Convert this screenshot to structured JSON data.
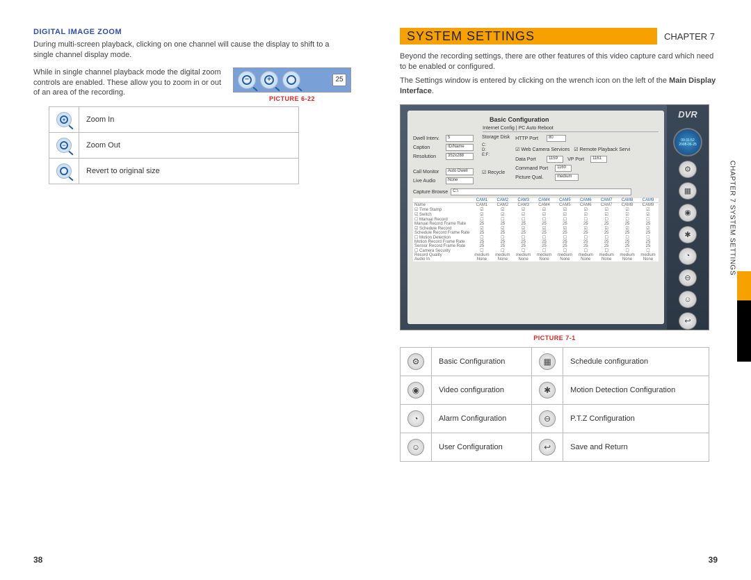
{
  "left": {
    "section_title": "DIGITAL IMAGE ZOOM",
    "para1": "During multi-screen playback, clicking on one channel will cause the display to shift to a single channel display mode.",
    "para2": "While in single channel playback mode the digital zoom controls are enabled. These allow you to zoom in or out of an area of the recording.",
    "pic622": {
      "label": "PICTURE 6-22",
      "num": "25"
    },
    "zoom_table": [
      {
        "icon": "zoom-in-icon",
        "text": "Zoom In"
      },
      {
        "icon": "zoom-out-icon",
        "text": "Zoom Out"
      },
      {
        "icon": "zoom-reset-icon",
        "text": "Revert to original size"
      }
    ],
    "page_num": "38"
  },
  "right": {
    "chapter_title": "SYSTEM SETTINGS",
    "chapter_num": "CHAPTER 7",
    "para1": "Beyond the recording settings, there are other features of this video capture card which need to be enabled or configured.",
    "para2_a": "The Settings window is entered by clicking on the wrench icon on the left of the ",
    "para2_bold": "Main Display Interface",
    "para2_b": ".",
    "screenshot": {
      "logo": "DVR",
      "clock_time": "09:31:52",
      "clock_date": "2008-06-25",
      "title": "Basic Configuration",
      "tabs": "Internet Config | PC Auto Reboot",
      "fields": {
        "dwell_label": "Dwell Interv.",
        "dwell_val": "5",
        "caption_label": "Caption",
        "caption_val": "ID/Name",
        "resolution_label": "Resolution",
        "resolution_val": "352x288",
        "callmon_label": "Call Monitor",
        "callmon_val": "Auto Dwell",
        "liveaudio_label": "Live Audio",
        "liveaudio_val": "None",
        "storage_label": "Storage Disk",
        "storage_c": "C:",
        "storage_d": "D:",
        "storage_ef": "E:F:",
        "recycle": "Recycle",
        "http_label": "HTTP Port",
        "http_val": "80",
        "data_label": "Data Port",
        "data_val": "1159",
        "cmd_label": "Command Port",
        "cmd_val": "1160",
        "picqual_label": "Picture Qual.",
        "picqual_val": "medium",
        "wcs": "Web Camera Services",
        "rps": "Remote Playback Servi",
        "vp_label": "VP Port",
        "vp_val": "1161"
      },
      "capture_label": "Capture Browse",
      "capture_val": "C:\\",
      "cam_headers": [
        "CAM1",
        "CAM2",
        "CAM3",
        "CAM4",
        "CAM5",
        "CAM6",
        "CAM7",
        "CAM8",
        "CAM9"
      ],
      "cam_rows": [
        "Name",
        "Time Stamp",
        "Switch",
        "Manual Record",
        "Manual Record Frame Rate",
        "Schedule Record",
        "Schedule Record Frame Rate",
        "Motion Detection",
        "Motion Record Frame Rate",
        "Sensor Record Frame Rate",
        "Camera Security",
        "Record Quality",
        "Audio In"
      ],
      "cam_vals_generic": [
        "25",
        "25",
        "25",
        "25",
        "25",
        "25",
        "25",
        "25",
        "25"
      ],
      "cam_quality": "medium",
      "cam_audio": "None"
    },
    "pic71_label": "PICTURE 7-1",
    "cfg_table": [
      [
        {
          "icon": "gear-icon",
          "text": "Basic Configuration"
        },
        {
          "icon": "calendar-icon",
          "text": "Schedule configuration"
        }
      ],
      [
        {
          "icon": "video-icon",
          "text": "Video configuration"
        },
        {
          "icon": "motion-icon",
          "text": "Motion Detection Configuration"
        }
      ],
      [
        {
          "icon": "bell-icon",
          "text": "Alarm Configuration"
        },
        {
          "icon": "ptz-icon",
          "text": "P.T.Z Configuration"
        }
      ],
      [
        {
          "icon": "user-icon",
          "text": "User Configuration"
        },
        {
          "icon": "save-icon",
          "text": "Save and Return"
        }
      ]
    ],
    "page_num": "39",
    "side_tab": "CHAPTER 7 SYSTEM SETTINGS"
  }
}
